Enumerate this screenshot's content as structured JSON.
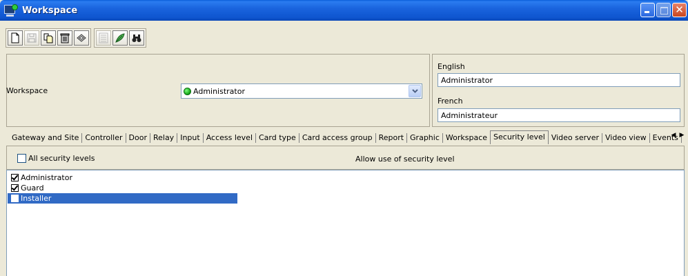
{
  "window": {
    "title": "Workspace"
  },
  "toolbar": {
    "buttons": [
      {
        "name": "new-icon",
        "disabled": false
      },
      {
        "name": "save-icon",
        "disabled": true
      },
      {
        "name": "copy-icon",
        "disabled": false
      },
      {
        "name": "delete-icon",
        "disabled": false
      },
      {
        "name": "print-icon",
        "disabled": false
      },
      {
        "name": "list-icon",
        "disabled": true
      },
      {
        "name": "feather-icon",
        "disabled": false
      },
      {
        "name": "binoculars-icon",
        "disabled": false
      }
    ]
  },
  "form": {
    "workspace_label": "Workspace",
    "workspace_value": "Administrator",
    "english_label": "English",
    "english_value": "Administrator",
    "french_label": "French",
    "french_value": "Administrateur"
  },
  "tabs": [
    {
      "label": "Gateway and Site"
    },
    {
      "label": "Controller"
    },
    {
      "label": "Door"
    },
    {
      "label": "Relay"
    },
    {
      "label": "Input"
    },
    {
      "label": "Access level"
    },
    {
      "label": "Card type"
    },
    {
      "label": "Card access group"
    },
    {
      "label": "Report"
    },
    {
      "label": "Graphic"
    },
    {
      "label": "Workspace"
    },
    {
      "label": "Security level",
      "active": true
    },
    {
      "label": "Video server"
    },
    {
      "label": "Video view"
    },
    {
      "label": "Events"
    }
  ],
  "security": {
    "all_label": "All security levels",
    "allow_label": "Allow use of security level",
    "items": [
      {
        "label": "Administrator",
        "checked": true,
        "selected": false
      },
      {
        "label": "Guard",
        "checked": true,
        "selected": false
      },
      {
        "label": "Installer",
        "checked": false,
        "selected": true
      }
    ]
  },
  "colors": {
    "title_bar": "#0a5fd9",
    "selection": "#316ac5",
    "window_bg": "#ece9d8"
  }
}
